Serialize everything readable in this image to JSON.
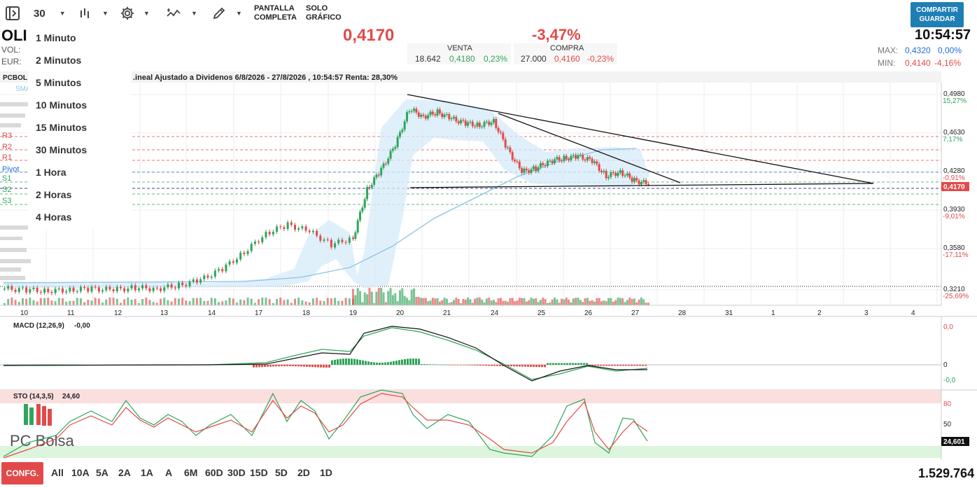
{
  "toolbar": {
    "interval": "30",
    "fullscreen_line1": "PANTALLA",
    "fullscreen_line2": "COMPLETA",
    "chartonly_line1": "SOLO",
    "chartonly_line2": "GRÁFICO",
    "share_line1": "COMPARTIR",
    "share_line2": "GUARDAR",
    "icons": [
      "sidebar-toggle-icon",
      "bars-icon",
      "gear-icon",
      "indicators-icon",
      "draw-pencil-icon",
      "chevron-down-icon"
    ]
  },
  "header": {
    "ticker": "OLI",
    "vol_label": "VOL:",
    "eur_label": "EUR:",
    "price": "0,4170",
    "change": "-3,47%",
    "sell": {
      "label": "VENTA",
      "qty": "18.642",
      "price": "0,4180",
      "pct": "0,23%"
    },
    "buy": {
      "label": "COMPRA",
      "qty": "27.000",
      "price": "0,4160",
      "pct": "-0,23%"
    },
    "time": "10:54:57",
    "max_label": "MAX:",
    "max_value": "0,4320",
    "max_pct": "0,00%",
    "min_label": "MIN:",
    "min_value": "0,4140",
    "min_pct": "-4,16%"
  },
  "interval_menu": [
    "1 Minuto",
    "2 Minutos",
    "5 Minutos",
    "10 Minutos",
    "15 Minutos",
    "30 Minutos",
    "1 Hora",
    "2 Horas",
    "4 Horas"
  ],
  "legend": {
    "source": "PCBOL",
    "info": ".ineal Ajustado a Dividenos 6/8/2026 - 27/8/2026 , 10:54:57 Renta: 28,30%",
    "sma": "SMA",
    "levels": [
      "R3",
      "R2",
      "R1",
      "Pivot",
      "S1",
      "S2",
      "S3"
    ]
  },
  "colors": {
    "up": "#2fa55a",
    "down": "#e24a4a",
    "accent": "#1f7fb5",
    "blue": "#1e6fd9"
  },
  "chart_data": [
    {
      "type": "candlestick",
      "title": "",
      "y_ticks": [
        "0,4980",
        "0,4630",
        "0,4280",
        "0,3930",
        "0,3580",
        "0,3210"
      ],
      "y_pct_labels": [
        "15,27%",
        "7,17%",
        "-0,91%",
        "-9,01%",
        "-17,11%",
        "-25,69%"
      ],
      "last_price_label": "0,4170",
      "x_ticks": [
        "10",
        "11",
        "12",
        "13",
        "14",
        "17",
        "18",
        "19",
        "20",
        "21",
        "24",
        "25",
        "26",
        "27",
        "28",
        "31",
        "1",
        "2",
        "3",
        "4"
      ],
      "close_approx": [
        0.322,
        0.321,
        0.32,
        0.321,
        0.322,
        0.321,
        0.323,
        0.322,
        0.325,
        0.33,
        0.34,
        0.355,
        0.372,
        0.38,
        0.374,
        0.362,
        0.368,
        0.412,
        0.43,
        0.452,
        0.485,
        0.478,
        0.482,
        0.476,
        0.472,
        0.47,
        0.474,
        0.448,
        0.428,
        0.431,
        0.438,
        0.44,
        0.442,
        0.438,
        0.424,
        0.428,
        0.42,
        0.417
      ],
      "pivot_levels": {
        "R3": 0.461,
        "R2": 0.449,
        "R1": 0.438,
        "Pivot": 0.426,
        "S1": 0.418,
        "S2": 0.414,
        "S3": 0.402
      }
    },
    {
      "type": "line",
      "title": "MACD (12,26,9)",
      "value_label": "-0,00",
      "y_ticks": [
        "0,0",
        "0",
        "-0,0"
      ]
    },
    {
      "type": "line",
      "title": "STO (14,3,5)",
      "value_label": "24,60",
      "y_ticks": [
        "80",
        "50"
      ],
      "last_value_label": "24,601"
    }
  ],
  "watermark": "PC Bolsa",
  "footer": {
    "config": "CONFG.",
    "ranges": [
      "All",
      "10A",
      "5A",
      "2A",
      "1A",
      "A",
      "6M",
      "60D",
      "30D",
      "15D",
      "5D",
      "2D",
      "1D"
    ],
    "volume": "1.529.764"
  }
}
